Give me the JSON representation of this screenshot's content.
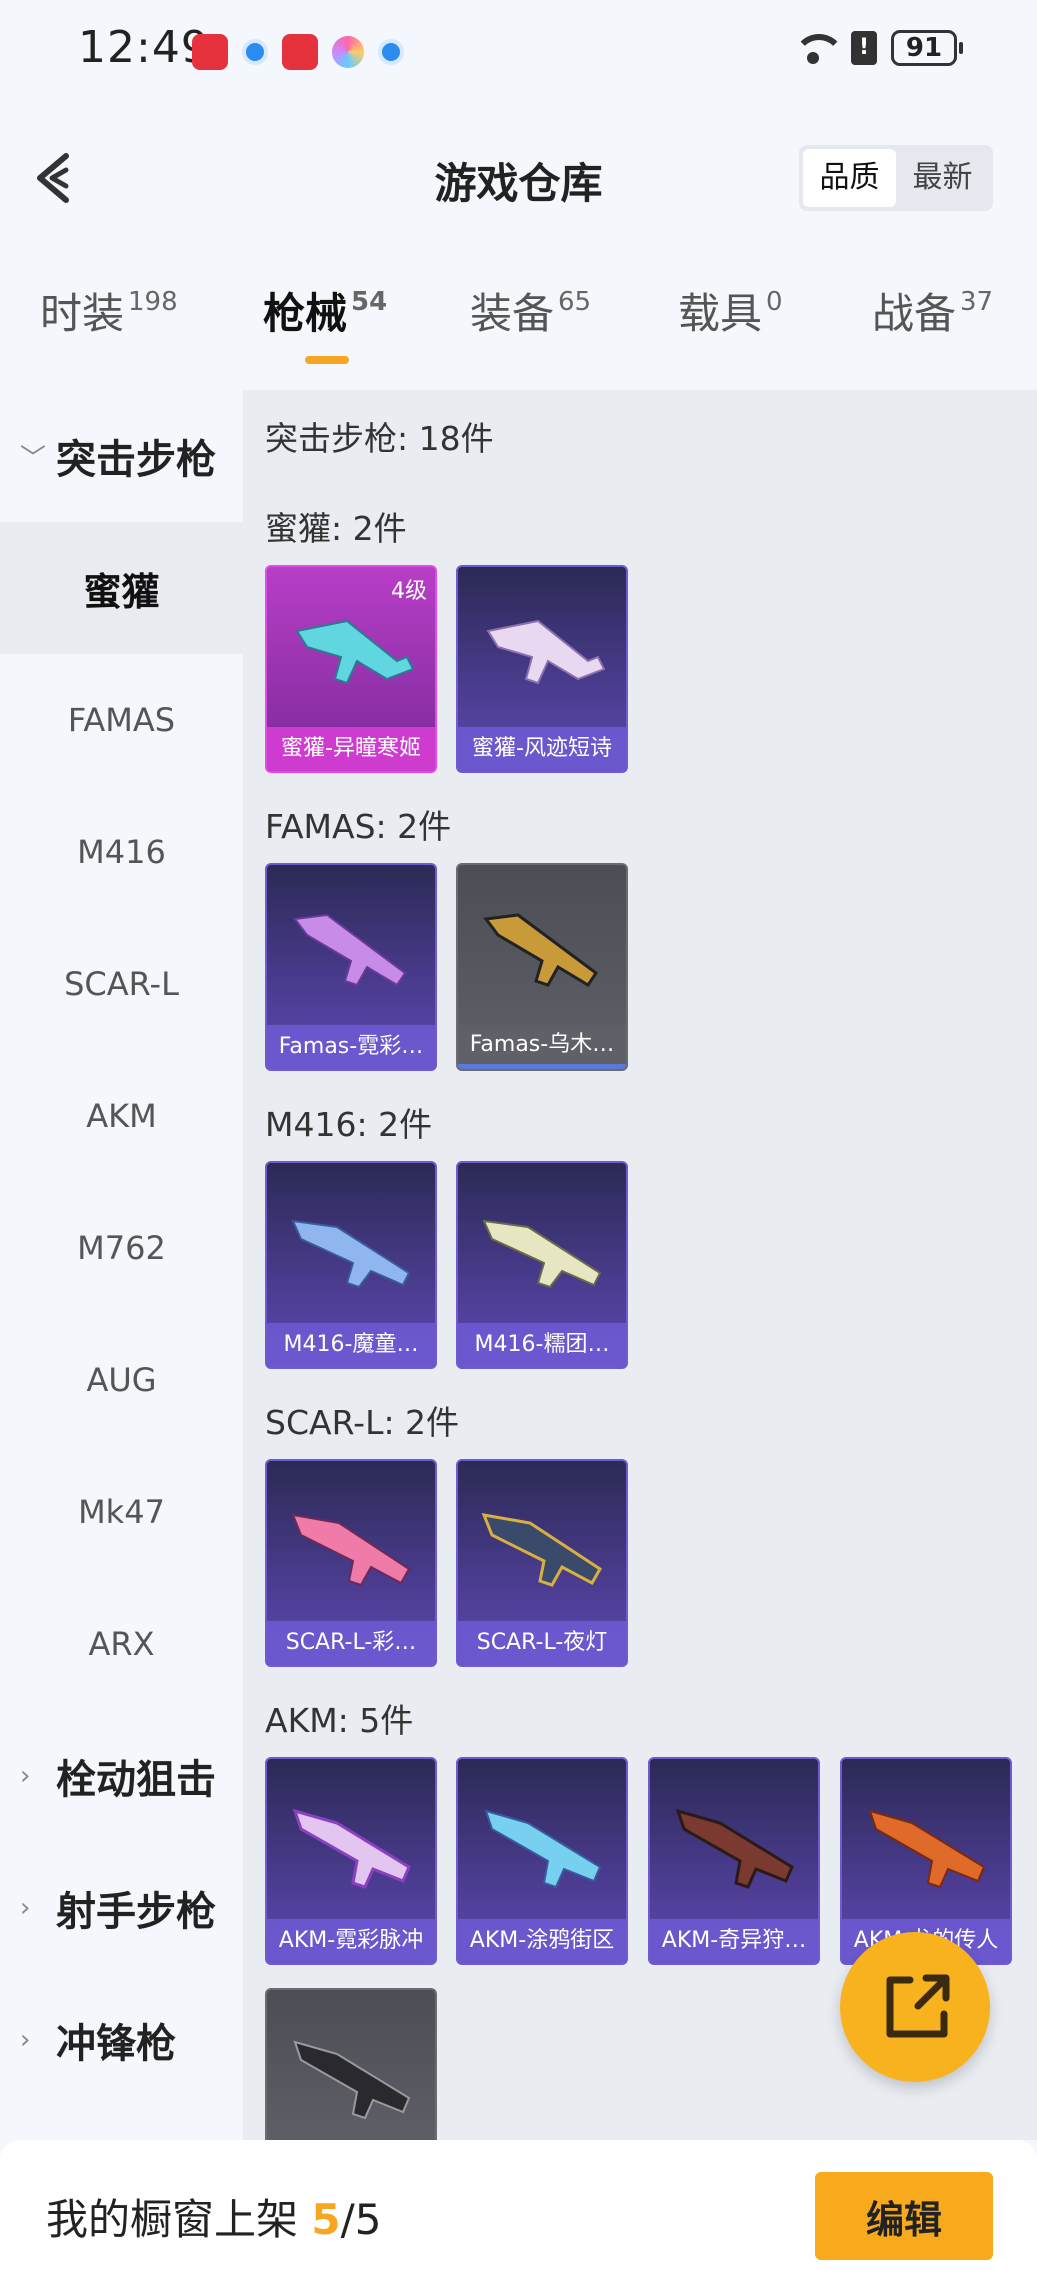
{
  "status_bar": {
    "time": "12:49",
    "battery": "91",
    "network": "6",
    "icons": [
      "huawei-app-icon",
      "browser-icon",
      "huawei-app-icon",
      "color-app-icon",
      "browser-icon",
      "wifi-icon",
      "sim-alert-icon",
      "battery-icon"
    ]
  },
  "header": {
    "title": "游戏仓库",
    "sort_options": [
      "品质",
      "最新"
    ],
    "sort_active": "品质"
  },
  "tabs": [
    {
      "label": "时装",
      "count": "198"
    },
    {
      "label": "枪械",
      "count": "54",
      "active": true
    },
    {
      "label": "装备",
      "count": "65"
    },
    {
      "label": "载具",
      "count": "0"
    },
    {
      "label": "战备",
      "count": "37"
    }
  ],
  "sidebar": {
    "groups": [
      {
        "label": "突击步枪",
        "expanded": true
      },
      {
        "label": "栓动狙击",
        "expanded": false
      },
      {
        "label": "射手步枪",
        "expanded": false
      },
      {
        "label": "冲锋枪",
        "expanded": false
      }
    ],
    "items": [
      "蜜獾",
      "FAMAS",
      "M416",
      "SCAR-L",
      "AKM",
      "M762",
      "AUG",
      "Mk47",
      "ARX"
    ],
    "active_item": "蜜獾"
  },
  "content": {
    "total": "突击步枪: 18件",
    "sections": [
      {
        "title": "蜜獾: 2件",
        "items": [
          {
            "name": "蜜獾-异瞳寒姬",
            "level": "4级",
            "style": "pink"
          },
          {
            "name": "蜜獾-风迹短诗",
            "style": "purple"
          }
        ]
      },
      {
        "title": "FAMAS: 2件",
        "items": [
          {
            "name": "Famas-霓彩…",
            "style": "purple"
          },
          {
            "name": "Famas-乌木…",
            "style": "grey"
          }
        ]
      },
      {
        "title": "M416: 2件",
        "items": [
          {
            "name": "M416-魔童…",
            "style": "purple"
          },
          {
            "name": "M416-糯团…",
            "style": "purple"
          }
        ]
      },
      {
        "title": "SCAR-L: 2件",
        "items": [
          {
            "name": "SCAR-L-彩…",
            "style": "purple"
          },
          {
            "name": "SCAR-L-夜灯",
            "style": "purple"
          }
        ]
      },
      {
        "title": "AKM: 5件",
        "items": [
          {
            "name": "AKM-霓彩脉冲",
            "style": "purple"
          },
          {
            "name": "AKM-涂鸦街区",
            "style": "purple"
          },
          {
            "name": "AKM-奇异狩…",
            "style": "purple"
          },
          {
            "name": "AKM-龙的传人",
            "style": "purple"
          },
          {
            "name": "",
            "style": "grey"
          }
        ]
      }
    ]
  },
  "bottom": {
    "label": "我的橱窗上架",
    "current": "5",
    "separator": "/",
    "max": "5",
    "edit_label": "编辑"
  },
  "colors": {
    "accent": "#f5a623",
    "card_purple": "#4b3c90",
    "card_pink": "#b83ec7",
    "card_grey": "#5f6068"
  }
}
